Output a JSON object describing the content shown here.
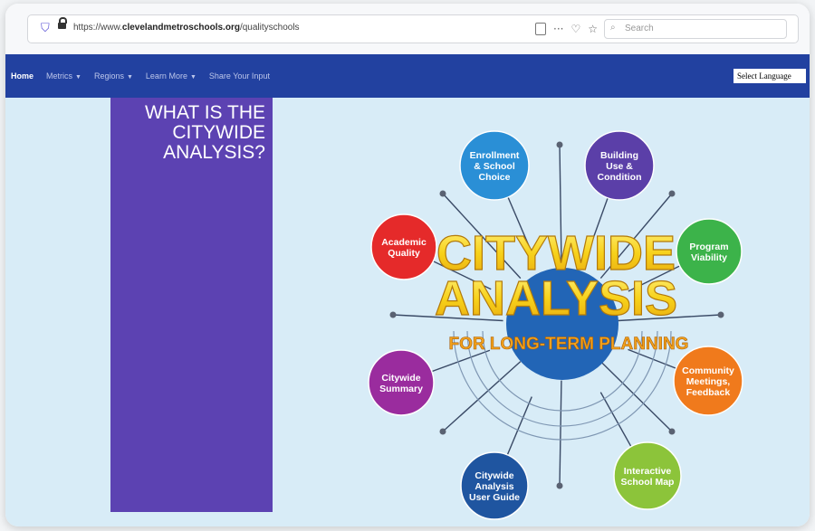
{
  "browser": {
    "url_prefix": "https://www.",
    "url_domain": "clevelandmetroschools.org",
    "url_path": "/qualityschools",
    "search_placeholder": "Search"
  },
  "nav": {
    "items": [
      {
        "label": "Home",
        "has_caret": false
      },
      {
        "label": "Metrics",
        "has_caret": true
      },
      {
        "label": "Regions",
        "has_caret": true
      },
      {
        "label": "Learn More",
        "has_caret": true
      },
      {
        "label": "Share Your Input",
        "has_caret": false
      }
    ],
    "language_select": "Select Language"
  },
  "panel": {
    "title_lines": [
      "WHAT IS THE",
      "CITYWIDE",
      "ANALYSIS?"
    ]
  },
  "infographic": {
    "title_line1": "CITYWIDE",
    "title_line2": "ANALYSIS",
    "subtitle": "FOR LONG-TERM PLANNING",
    "nodes": [
      {
        "id": "enrollment",
        "lines": [
          "Enrollment",
          "& School",
          "Choice"
        ],
        "color": "#2a8fd6"
      },
      {
        "id": "building",
        "lines": [
          "Building",
          "Use &",
          "Condition"
        ],
        "color": "#5b3fa8"
      },
      {
        "id": "program",
        "lines": [
          "Program",
          "Viability"
        ],
        "color": "#3cb34a"
      },
      {
        "id": "community",
        "lines": [
          "Community",
          "Meetings,",
          "Feedback"
        ],
        "color": "#f07a1c"
      },
      {
        "id": "map",
        "lines": [
          "Interactive",
          "School Map"
        ],
        "color": "#8cc43a"
      },
      {
        "id": "guide",
        "lines": [
          "Citywide",
          "Analysis",
          "User Guide"
        ],
        "color": "#1f55a0"
      },
      {
        "id": "summary",
        "lines": [
          "Citywide",
          "Summary"
        ],
        "color": "#9a2c9e"
      },
      {
        "id": "academic",
        "lines": [
          "Academic",
          "Quality"
        ],
        "color": "#e52a2a"
      }
    ],
    "colors": {
      "title_yellow": "#f7d21a",
      "subtitle_orange": "#f3a21b",
      "center_blue": "#2265b6"
    }
  }
}
